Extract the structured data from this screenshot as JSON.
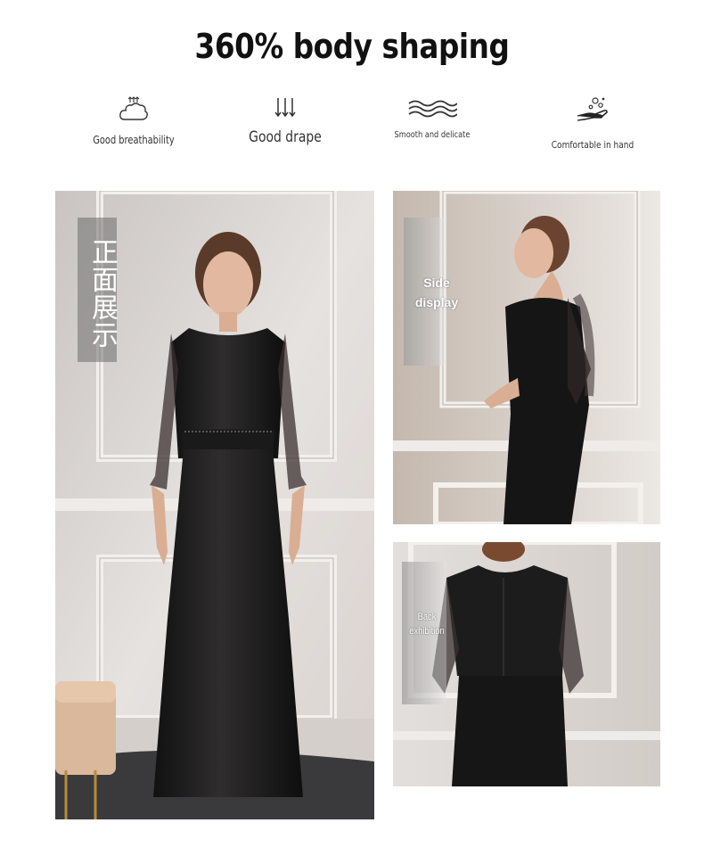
{
  "header": {
    "title": "360% body shaping"
  },
  "features": [
    {
      "icon": "breathable-cloud-icon",
      "label": "Good breathability"
    },
    {
      "icon": "down-arrows-icon",
      "label": "Good drape"
    },
    {
      "icon": "waves-icon",
      "label": "Smooth and delicate"
    },
    {
      "icon": "hand-bubbles-icon",
      "label": "Comfortable in hand"
    }
  ],
  "photos": {
    "front": {
      "tag": "正面展示"
    },
    "side": {
      "tag": "Side display"
    },
    "back": {
      "tag": "Back exhibition"
    }
  }
}
